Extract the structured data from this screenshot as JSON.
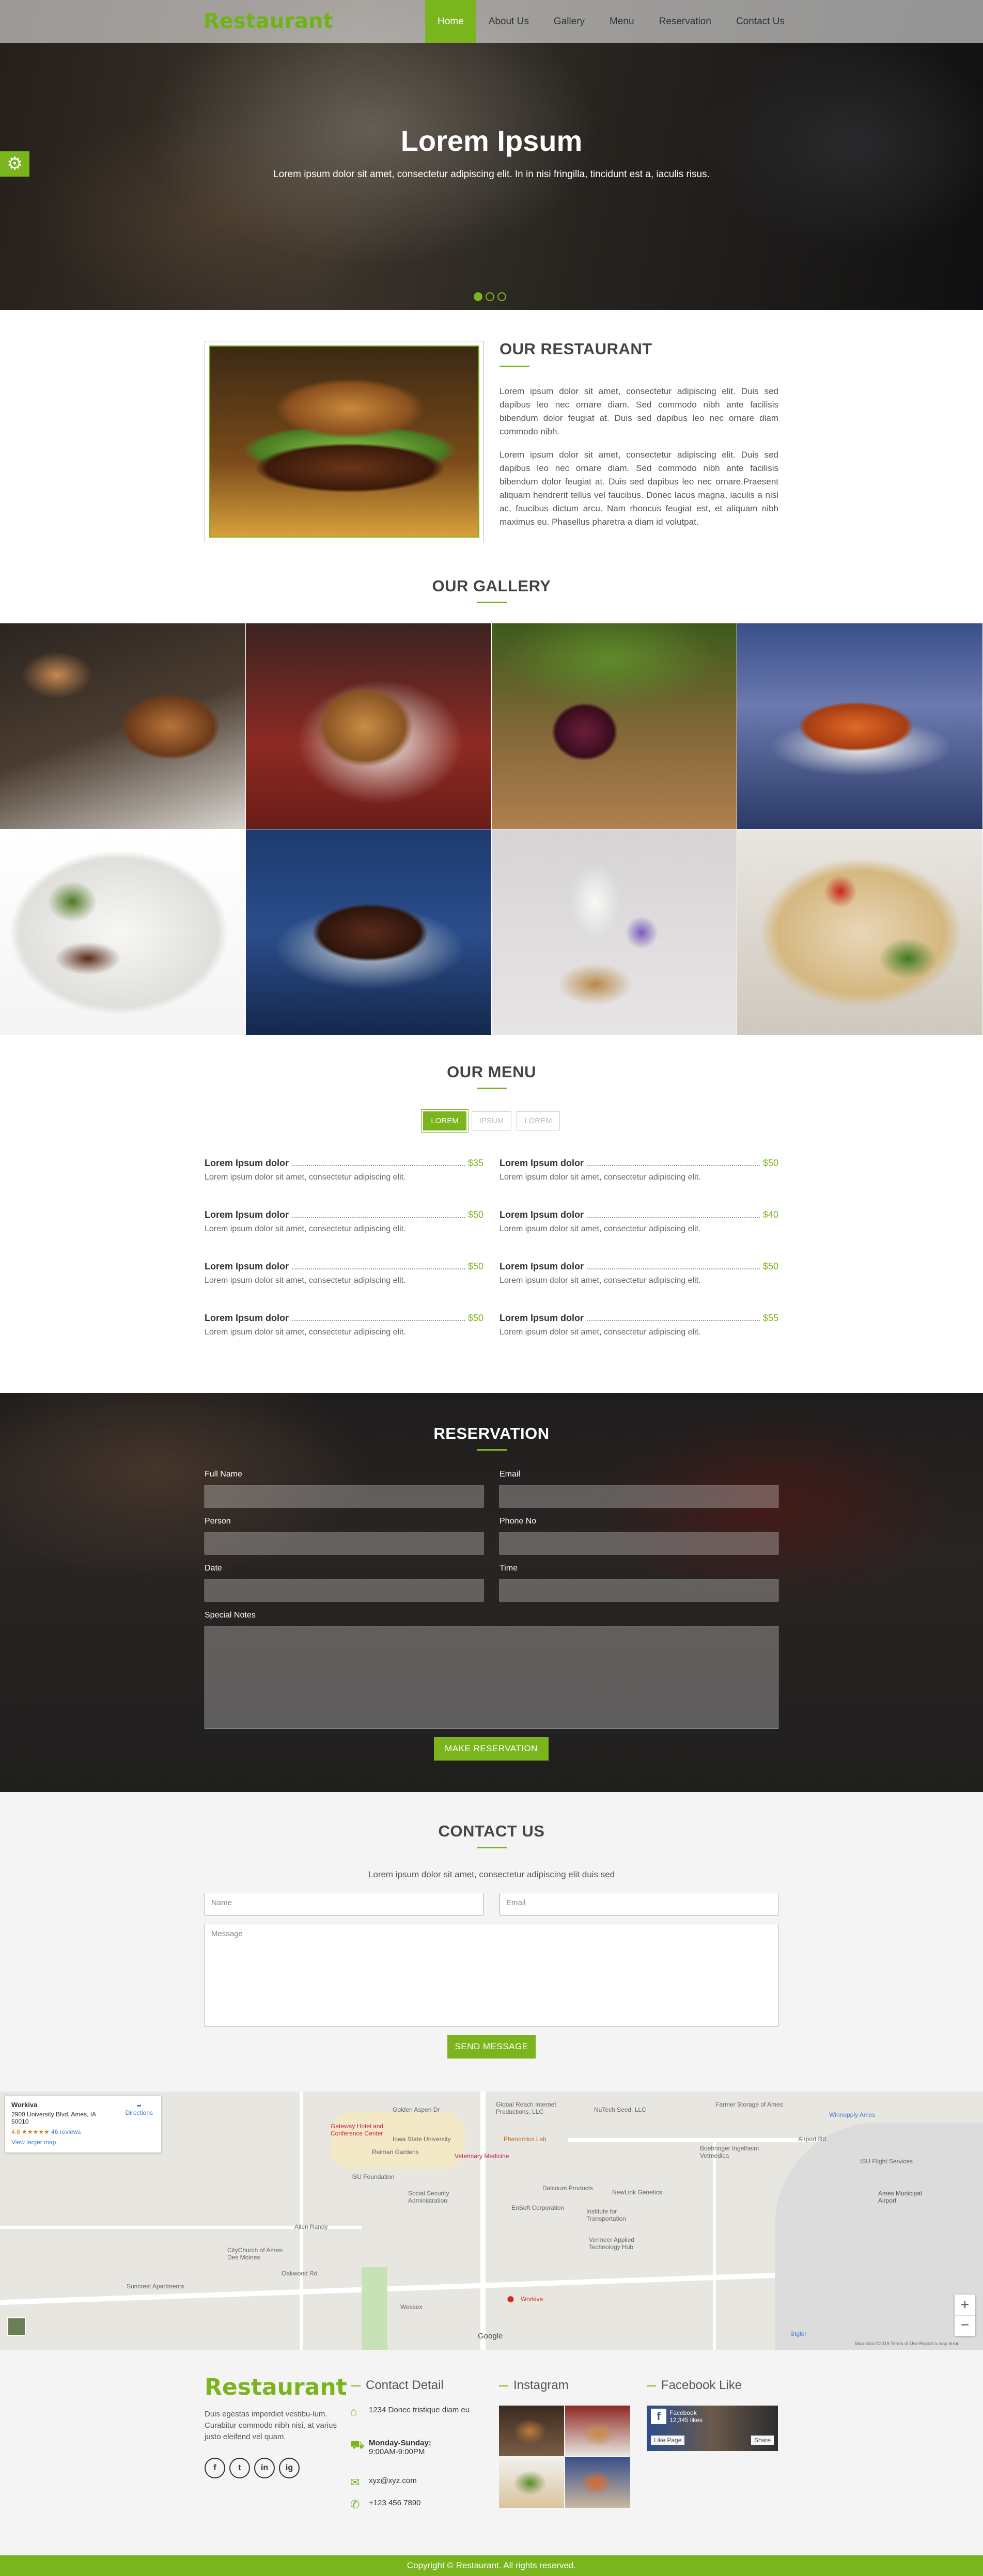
{
  "nav": {
    "logo": "Restaurant",
    "items": [
      "Home",
      "About Us",
      "Gallery",
      "Menu",
      "Reservation",
      "Contact Us"
    ],
    "active": "Home"
  },
  "hero": {
    "title": "Lorem Ipsum",
    "subtitle": "Lorem ipsum dolor sit amet, consectetur adipiscing elit. In in nisi fringilla, tincidunt est a, iaculis risus.",
    "slides": 3,
    "active_slide": 1
  },
  "about": {
    "title": "OUR RESTAURANT",
    "p1": "Lorem ipsum dolor sit amet, consectetur adipiscing elit. Duis sed dapibus leo nec ornare diam. Sed commodo nibh ante facilisis bibendum dolor feugiat at. Duis sed dapibus leo nec ornare diam commodo nibh.",
    "p2": "Lorem ipsum dolor sit amet, consectetur adipiscing elit. Duis sed dapibus leo nec ornare diam. Sed commodo nibh ante facilisis bibendum dolor feugiat at. Duis sed dapibus leo nec ornare.Praesent aliquam hendrerit tellus vel faucibus. Donec lacus magna, iaculis a nisl ac, faucibus dictum arcu. Nam rhoncus feugiat est, et aliquam nibh maximus eu. Phasellus pharetra a diam id volutpat."
  },
  "gallery": {
    "title": "OUR GALLERY"
  },
  "menu": {
    "title": "OUR MENU",
    "tabs": [
      "LOREM",
      "IPSUM",
      "LOREM"
    ],
    "active_tab": "LOREM",
    "items": [
      {
        "name": "Lorem Ipsum dolor",
        "price": "$35",
        "desc": "Lorem ipsum dolor sit amet, consectetur adipiscing elit."
      },
      {
        "name": "Lorem Ipsum dolor",
        "price": "$50",
        "desc": "Lorem ipsum dolor sit amet, consectetur adipiscing elit."
      },
      {
        "name": "Lorem Ipsum dolor",
        "price": "$50",
        "desc": "Lorem ipsum dolor sit amet, consectetur adipiscing elit."
      },
      {
        "name": "Lorem Ipsum dolor",
        "price": "$40",
        "desc": "Lorem ipsum dolor sit amet, consectetur adipiscing elit."
      },
      {
        "name": "Lorem Ipsum dolor",
        "price": "$50",
        "desc": "Lorem ipsum dolor sit amet, consectetur adipiscing elit."
      },
      {
        "name": "Lorem Ipsum dolor",
        "price": "$50",
        "desc": "Lorem ipsum dolor sit amet, consectetur adipiscing elit."
      },
      {
        "name": "Lorem Ipsum dolor",
        "price": "$50",
        "desc": "Lorem ipsum dolor sit amet, consectetur adipiscing elit."
      },
      {
        "name": "Lorem Ipsum dolor",
        "price": "$55",
        "desc": "Lorem ipsum dolor sit amet, consectetur adipiscing elit."
      }
    ]
  },
  "reservation": {
    "title": "RESERVATION",
    "fields": {
      "full_name": "Full Name",
      "email": "Email",
      "person": "Person",
      "phone": "Phone No",
      "date": "Date",
      "time": "Time",
      "notes": "Special Notes"
    },
    "button": "MAKE RESERVATION"
  },
  "contact": {
    "title": "CONTACT US",
    "subtitle": "Lorem ipsum dolor sit amet, consectetur adipiscing elit duis sed",
    "name_placeholder": "Name",
    "email_placeholder": "Email",
    "message_placeholder": "Message",
    "button": "SEND MESSAGE"
  },
  "map": {
    "card_name": "Workiva",
    "card_address": "2900 University Blvd, Ames, IA 50010",
    "rating": "4.8 ★★★★★",
    "reviews": "46 reviews",
    "larger_map": "View larger map",
    "directions": "Directions",
    "pin_label": "Workiva",
    "google": "Google",
    "footer_note": "Map data ©2019   Terms of Use   Report a map error",
    "labels": [
      "Golden Aspen Dr",
      "Global Reach Internet Productions, LLC",
      "NuTech Seed, LLC",
      "Farmer Storage of Ames",
      "Winnopply Ames",
      "Airport Rd",
      "Boehringer Ingelheim Vetmedica",
      "ISU Flight Services",
      "Ames Municipal Airport",
      "Iowa State University",
      "Phenomics Lab",
      "ISU Foundation",
      "Social Security Administration",
      "Dalcoum Products",
      "NewLink Genetics",
      "Institute for Transportation",
      "Vermeer Applied Technology Hub",
      "EnSoft Corporation",
      "Allen Randy",
      "CityChurch of Ames-Des Moines",
      "Suncrest Apartments",
      "Oakwood Rd",
      "Wessex",
      "Stgler",
      "Reiman Gardens",
      "Veterinary Medicine",
      "Gateway Hotel and Conference Center"
    ]
  },
  "footer": {
    "logo": "Restaurant",
    "text": "Duis egestas imperdiet vestibu-lum. Curabitur commodo nibh nisi, at varius justo eleifend vel quam.",
    "social": [
      "f",
      "t",
      "in",
      "ig"
    ],
    "contact_title": "Contact Detail",
    "address": "1234 Donec tristique diam eu",
    "hours_label": "Monday-Sunday:",
    "hours": "9:00AM-9:00PM",
    "email": "xyz@xyz.com",
    "phone": "+123 456 7890",
    "instagram_title": "Instagram",
    "facebook_title": "Facebook Like",
    "fb_name": "Facebook",
    "fb_likes": "12,345 likes",
    "fb_like_page": "Like Page",
    "fb_share": "Share",
    "copyright": "Copyright © Restaurant. All rights reserved."
  },
  "colors": {
    "accent": "#7ab51d",
    "dark": "#333333",
    "bg_light": "#f4f4f4"
  }
}
